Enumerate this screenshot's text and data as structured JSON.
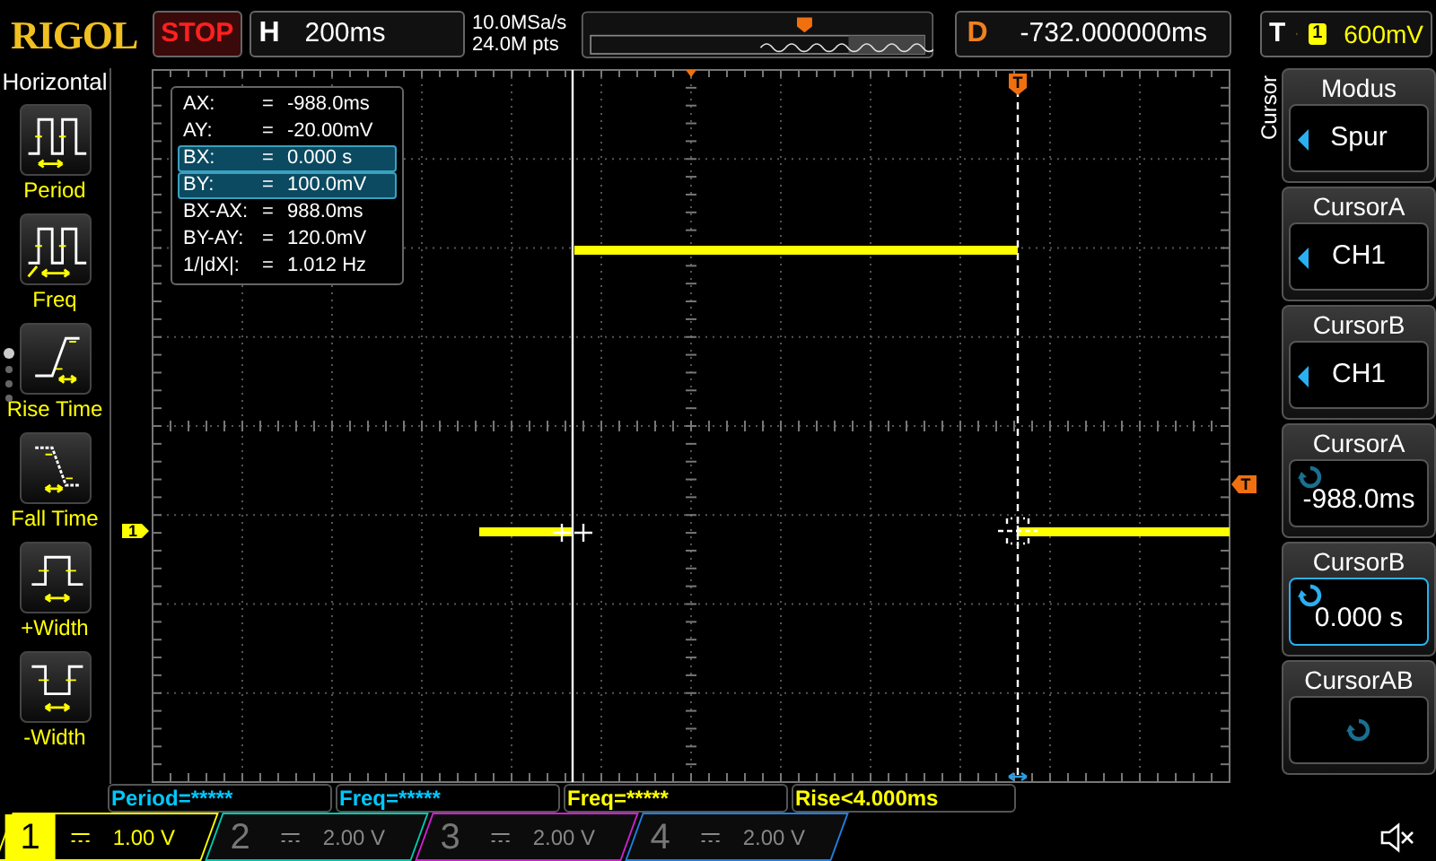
{
  "header": {
    "logo": "RIGOL",
    "run_state": "STOP",
    "timebase_label": "H",
    "timebase": "200ms",
    "sample_rate": "10.0MSa/s",
    "memory_depth": "24.0M pts",
    "delay_label": "D",
    "delay": "-732.000000ms",
    "trigger_label": "T",
    "trigger_source": "1",
    "trigger_level": "600mV"
  },
  "left_menu": {
    "title": "Horizontal",
    "items": [
      {
        "label": "Period",
        "kind": "period"
      },
      {
        "label": "Freq",
        "kind": "freq"
      },
      {
        "label": "Rise Time",
        "kind": "rise"
      },
      {
        "label": "Fall Time",
        "kind": "fall"
      },
      {
        "label": "+Width",
        "kind": "pwidth"
      },
      {
        "label": "-Width",
        "kind": "nwidth"
      }
    ]
  },
  "plot": {
    "channel_marker": "1",
    "trigger_marker": "T",
    "trigger_position_marker": "T"
  },
  "cursor_readout": [
    {
      "label": "AX:",
      "equals": "=",
      "value": "-988.0ms",
      "selected": false
    },
    {
      "label": "AY:",
      "equals": "=",
      "value": "-20.00mV",
      "selected": false
    },
    {
      "label": "BX:",
      "equals": "=",
      "value": "0.000 s",
      "selected": true
    },
    {
      "label": "BY:",
      "equals": "=",
      "value": "100.0mV",
      "selected": true
    },
    {
      "label": "BX-AX:",
      "equals": "=",
      "value": "988.0ms",
      "selected": false
    },
    {
      "label": "BY-AY:",
      "equals": "=",
      "value": "120.0mV",
      "selected": false
    },
    {
      "label": "1/|dX|:",
      "equals": "=",
      "value": "1.012 Hz",
      "selected": false
    }
  ],
  "right_menu": {
    "title": "Cursor",
    "items": [
      {
        "label": "Modus",
        "value": "Spur",
        "kind": "select",
        "selected": false
      },
      {
        "label": "CursorA",
        "value": "CH1",
        "kind": "select",
        "selected": false
      },
      {
        "label": "CursorB",
        "value": "CH1",
        "kind": "select",
        "selected": false
      },
      {
        "label": "CursorA",
        "value": "-988.0ms",
        "kind": "knob",
        "selected": false
      },
      {
        "label": "CursorB",
        "value": "0.000 s",
        "kind": "knob",
        "selected": true
      },
      {
        "label": "CursorAB",
        "kind": "knob",
        "selected": false
      }
    ]
  },
  "measurements": [
    {
      "text": "Period=*****",
      "color": "#00c8ff"
    },
    {
      "text": "Freq=*****",
      "color": "#00c8ff"
    },
    {
      "text": "Freq=*****",
      "color": "#ffff00"
    },
    {
      "text": "Rise<4.000ms",
      "color": "#ffff00"
    }
  ],
  "channels": [
    {
      "number": "1",
      "scale": "1.00 V",
      "selected": true,
      "color": "#ffff00"
    },
    {
      "number": "2",
      "scale": "2.00 V",
      "selected": false,
      "color": "#00c8b0"
    },
    {
      "number": "3",
      "scale": "2.00 V",
      "selected": false,
      "color": "#d020d0"
    },
    {
      "number": "4",
      "scale": "2.00 V",
      "selected": false,
      "color": "#2080e0"
    }
  ]
}
